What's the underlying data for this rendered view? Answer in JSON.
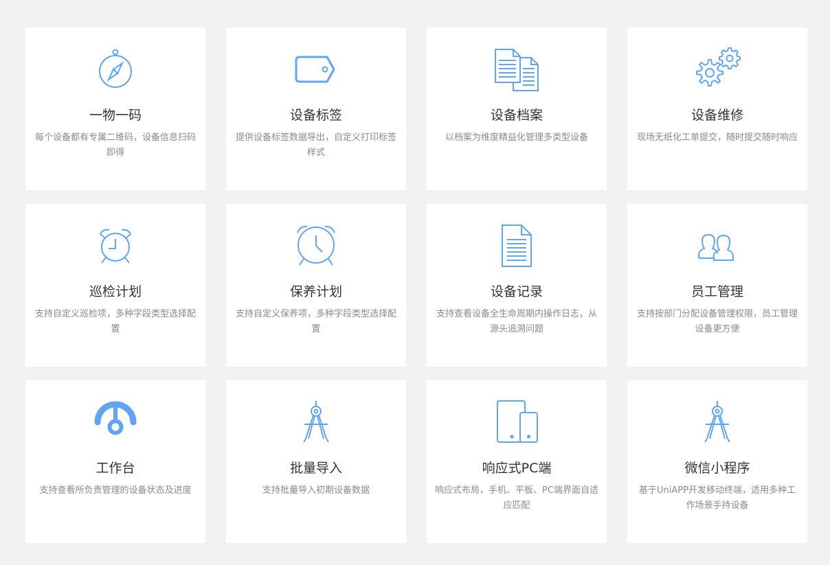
{
  "colors": {
    "background": "#f2f2f2",
    "card": "#ffffff",
    "icon": "#5ea5f5",
    "title": "#333333",
    "description": "#8a8a8a"
  },
  "features": [
    {
      "icon": "compass-icon",
      "title": "一物一码",
      "description": "每个设备都有专属二维码，设备信息扫码即得"
    },
    {
      "icon": "tag-icon",
      "title": "设备标签",
      "description": "提供设备标签数据导出，自定义打印标签样式"
    },
    {
      "icon": "documents-icon",
      "title": "设备档案",
      "description": "以档案为维度精益化管理多类型设备"
    },
    {
      "icon": "gears-icon",
      "title": "设备维修",
      "description": "现场无纸化工单提交，随时提交随时响应"
    },
    {
      "icon": "alarm-clock-icon",
      "title": "巡检计划",
      "description": "支持自定义巡检项，多种字段类型选择配置"
    },
    {
      "icon": "alarm-clock-icon",
      "title": "保养计划",
      "description": "支持自定义保养项，多种字段类型选择配置"
    },
    {
      "icon": "document-icon",
      "title": "设备记录",
      "description": "支持查看设备全生命周期内操作日志，从源头追溯问题"
    },
    {
      "icon": "users-icon",
      "title": "员工管理",
      "description": "支持按部门分配设备管理权限，员工管理设备更方便"
    },
    {
      "icon": "dashboard-gauge-icon",
      "title": "工作台",
      "description": "支持查看所负责管理的设备状态及进度"
    },
    {
      "icon": "drafting-compass-icon",
      "title": "批量导入",
      "description": "支持批量导入初期设备数据"
    },
    {
      "icon": "tablet-phone-icon",
      "title": "响应式PC端",
      "description": "响应式布局，手机、平板、PC端界面自适应匹配"
    },
    {
      "icon": "drafting-compass-icon",
      "title": "微信小程序",
      "description": "基于UniAPP开发移动终端，适用多种工作场景手持设备"
    }
  ]
}
